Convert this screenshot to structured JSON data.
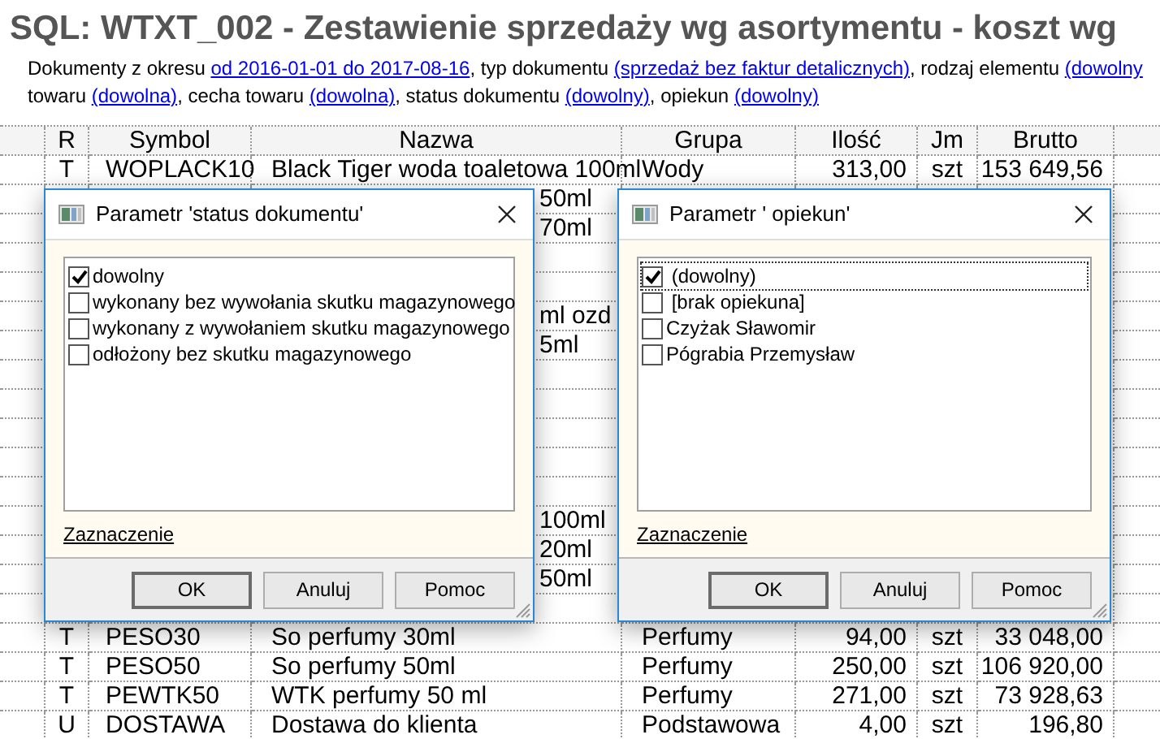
{
  "report": {
    "title": "SQL: WTXT_002 - Zestawienie sprzedaży wg asortymentu - koszt wg",
    "description_lines": [
      [
        {
          "text": "Dokumenty z okresu ",
          "kind": "text"
        },
        {
          "text": "od 2016-01-01 do 2017-08-16",
          "kind": "link"
        },
        {
          "text": ", typ dokumentu ",
          "kind": "text"
        },
        {
          "text": "(sprzedaż bez faktur detalicznych)",
          "kind": "link"
        },
        {
          "text": ", rodzaj elementu ",
          "kind": "text"
        },
        {
          "text": "(dowolny",
          "kind": "link"
        }
      ],
      [
        {
          "text": "towaru ",
          "kind": "text"
        },
        {
          "text": "(dowolna)",
          "kind": "link"
        },
        {
          "text": ", cecha towaru ",
          "kind": "text"
        },
        {
          "text": "(dowolna)",
          "kind": "link"
        },
        {
          "text": ", status dokumentu ",
          "kind": "text"
        },
        {
          "text": "(dowolny)",
          "kind": "link"
        },
        {
          "text": ", opiekun ",
          "kind": "text"
        },
        {
          "text": "(dowolny)",
          "kind": "link"
        }
      ]
    ]
  },
  "table": {
    "columns": [
      "R",
      "Symbol",
      "Nazwa",
      "Grupa",
      "Ilość",
      "Jm",
      "Brutto"
    ],
    "rows": [
      {
        "kind": "full",
        "r": "T",
        "symbol": "WOPLACK10",
        "nazwa": "Black Tiger woda toaletowa 100ml",
        "grupa": "Wody",
        "ilosc": "313,00",
        "jm": "szt",
        "brutto": "153 649,56"
      },
      {
        "kind": "fragment",
        "nazwa": "50ml"
      },
      {
        "kind": "fragment",
        "nazwa": "70ml"
      },
      {
        "kind": "fragment"
      },
      {
        "kind": "fragment"
      },
      {
        "kind": "fragment",
        "nazwa": "ml ozd"
      },
      {
        "kind": "fragment",
        "nazwa": "5ml"
      },
      {
        "kind": "fragment"
      },
      {
        "kind": "fragment"
      },
      {
        "kind": "fragment"
      },
      {
        "kind": "fragment"
      },
      {
        "kind": "fragment"
      },
      {
        "kind": "fragment",
        "nazwa": "100ml"
      },
      {
        "kind": "fragment",
        "nazwa": "20ml"
      },
      {
        "kind": "fragment",
        "nazwa": "50ml"
      },
      {
        "kind": "fragment"
      },
      {
        "kind": "full",
        "r": "T",
        "symbol": "PESO30",
        "nazwa": "So perfumy 30ml",
        "grupa": "Perfumy",
        "ilosc": "94,00",
        "jm": "szt",
        "brutto": "33 048,00"
      },
      {
        "kind": "full",
        "r": "T",
        "symbol": "PESO50",
        "nazwa": "So perfumy 50ml",
        "grupa": "Perfumy",
        "ilosc": "250,00",
        "jm": "szt",
        "brutto": "106 920,00"
      },
      {
        "kind": "full",
        "r": "T",
        "symbol": "PEWTK50",
        "nazwa": "WTK perfumy 50 ml",
        "grupa": "Perfumy",
        "ilosc": "271,00",
        "jm": "szt",
        "brutto": "73 928,63"
      },
      {
        "kind": "full",
        "r": "U",
        "symbol": "DOSTAWA",
        "nazwa": "Dostawa do klienta",
        "grupa": "Podstawowa",
        "ilosc": "4,00",
        "jm": "szt",
        "brutto": "196,80"
      }
    ]
  },
  "dialogs": [
    {
      "title": "Parametr 'status dokumentu'",
      "items": [
        {
          "label": "dowolny",
          "checked": true,
          "focused": false
        },
        {
          "label": "wykonany bez wywołania skutku magazynowego",
          "checked": false,
          "focused": false
        },
        {
          "label": "wykonany z wywołaniem skutku magazynowego",
          "checked": false,
          "focused": false
        },
        {
          "label": "odłożony bez skutku magazynowego",
          "checked": false,
          "focused": false
        }
      ],
      "link": "Zaznaczenie",
      "buttons": [
        "OK",
        "Anuluj",
        "Pomoc"
      ]
    },
    {
      "title": "Parametr ' opiekun'",
      "items": [
        {
          "label": " (dowolny)",
          "checked": true,
          "focused": true
        },
        {
          "label": " [brak opiekuna]",
          "checked": false,
          "focused": false
        },
        {
          "label": "Czyżak Sławomir",
          "checked": false,
          "focused": false
        },
        {
          "label": "Pógrabia Przemysław",
          "checked": false,
          "focused": false
        }
      ],
      "link": "Zaznaczenie",
      "buttons": [
        "OK",
        "Anuluj",
        "Pomoc"
      ]
    }
  ]
}
